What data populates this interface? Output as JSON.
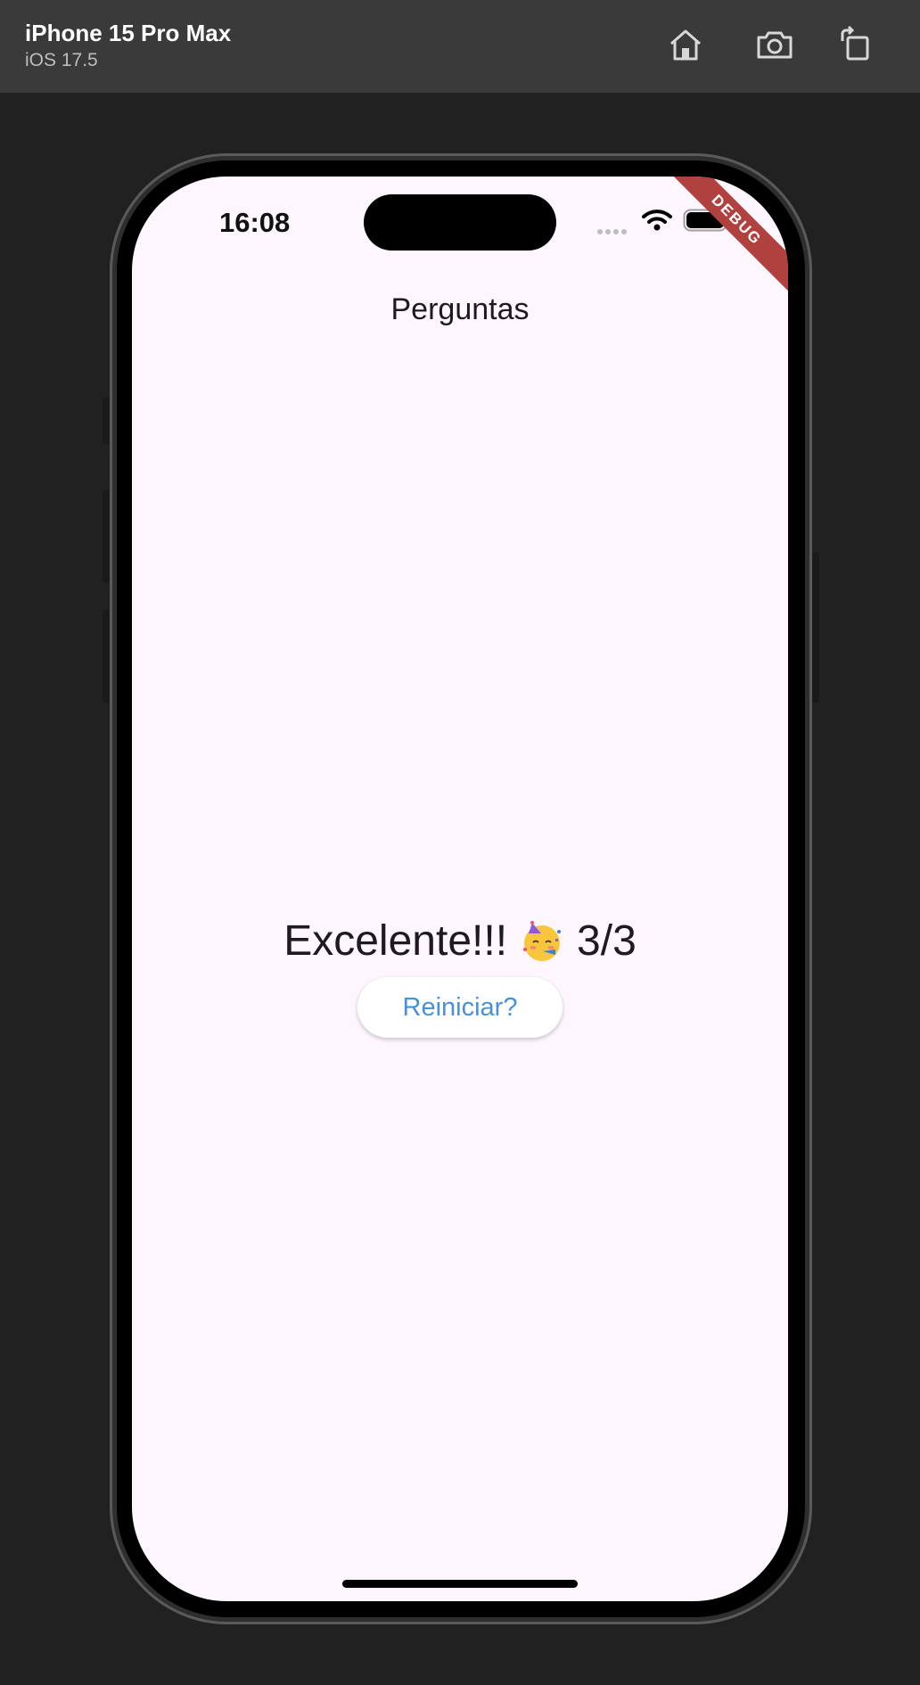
{
  "simulator": {
    "device_name": "iPhone 15 Pro Max",
    "os_version": "iOS 17.5",
    "toolbar_icons": [
      "home-icon",
      "screenshot-icon",
      "rotate-icon"
    ]
  },
  "status_bar": {
    "time": "16:08",
    "icons": [
      "signal-icon",
      "wifi-icon",
      "battery-icon"
    ]
  },
  "debug_banner": "DEBUG",
  "app_bar": {
    "title": "Perguntas"
  },
  "result": {
    "message": "Excelente!!!",
    "emoji_icon": "partying-face-icon",
    "score": "3/3"
  },
  "restart_button": {
    "label": "Reiniciar?"
  },
  "colors": {
    "background": "#fdf7fd",
    "button_text": "#4a90d9",
    "debug_banner": "#b0413e"
  }
}
